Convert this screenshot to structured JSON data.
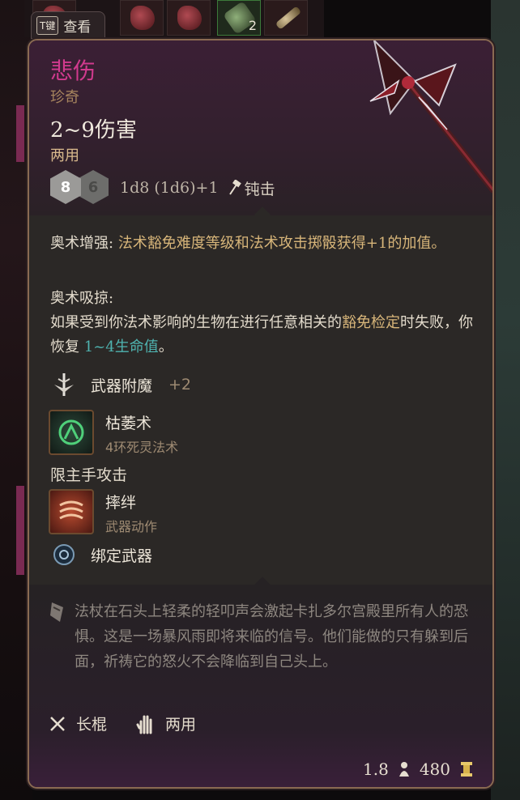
{
  "hotbar": {
    "slot_count": "2",
    "inspect_key": "T键",
    "inspect_label": "查看"
  },
  "item": {
    "name": "悲伤",
    "rarity": "珍奇",
    "damage": "2~9伤害",
    "handedness": "两用",
    "dice": {
      "d8_label": "8",
      "d6_label": "6"
    },
    "dice_formula": "1d8 (1d6)+1",
    "damage_type": "钝击",
    "arcane_enhance": {
      "label": "奥术增强:",
      "text": "法术豁免难度等级和法术攻击掷骰获得+1的加值。"
    },
    "arcane_drain": {
      "label": "奥术吸掠:",
      "text_prefix": "如果受到你法术影响的生物在进行任意相关的",
      "keyword": "豁免检定",
      "text_mid": "时失败，你恢复 ",
      "heal": "1~4生命值",
      "text_end": "。"
    },
    "enchant": {
      "label": "武器附魔",
      "value": "+2"
    },
    "spell": {
      "name": "枯萎术",
      "sub": "4环死灵法术"
    },
    "mainhand_label": "限主手攻击",
    "action": {
      "name": "摔绊",
      "sub": "武器动作"
    },
    "bind": {
      "label": "绑定武器"
    },
    "lore": "法杖在石头上轻柔的轻叩声会激起卡扎多尔宫殿里所有人的恐惧。这是一场暴风雨即将来临的信号。他们能做的只有躲到后面，祈祷它的怒火不会降临到自己头上。",
    "props": {
      "type": "长棍",
      "handedness": "两用"
    },
    "weight": "1.8",
    "value": "480"
  },
  "colors": {
    "title": "#d13a8e",
    "rarity": "#a7855e",
    "heal": "#4fb3b0",
    "border": "#8a6a52"
  },
  "icons": [
    "d8-die-icon",
    "d6-die-icon",
    "hammer-icon",
    "sword-enchant-icon",
    "blight-spell-icon",
    "topple-action-icon",
    "bind-weapon-icon",
    "lore-scroll-icon",
    "quarterstaff-icon",
    "two-hand-icon",
    "weight-icon",
    "gold-icon",
    "weapon-art"
  ]
}
